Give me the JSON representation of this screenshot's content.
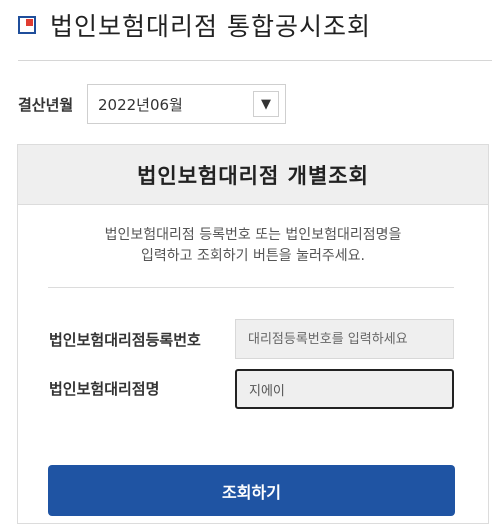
{
  "header": {
    "title": "법인보험대리점 통합공시조회",
    "icon": "logo-square-icon"
  },
  "period": {
    "label": "결산년월",
    "selected": "2022년06월"
  },
  "panel": {
    "title": "법인보험대리점 개별조회",
    "guide_line1": "법인보험대리점 등록번호 또는 법인보험대리점명을",
    "guide_line2": "입력하고 조회하기 버튼을 눌러주세요.",
    "reg_label": "법인보험대리점등록번호",
    "reg_placeholder": "대리점등록번호를 입력하세요",
    "name_label": "법인보험대리점명",
    "name_value": "지에이",
    "search_label": "조회하기"
  },
  "colors": {
    "brand_blue": "#1f54a3",
    "accent_red": "#e03c31"
  }
}
